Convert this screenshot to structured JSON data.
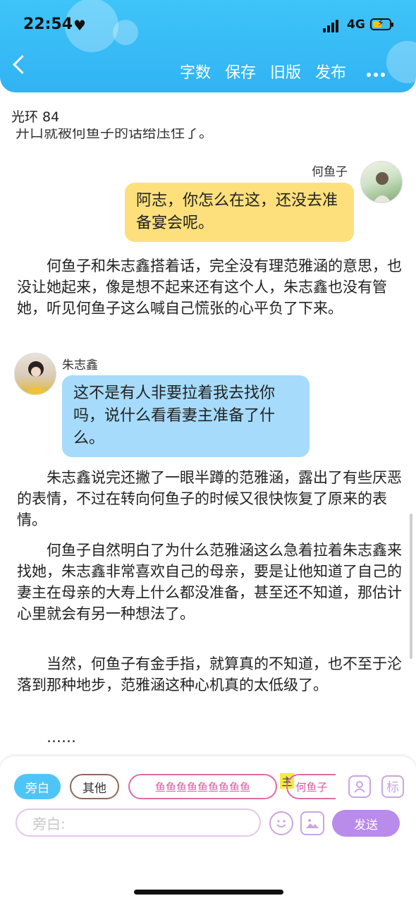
{
  "status_bar": {
    "time": "22:54",
    "network": "4G"
  },
  "nav": {
    "word_count": "字数",
    "save": "保存",
    "old_version": "旧版",
    "publish": "发布"
  },
  "document": {
    "title": "光环 84",
    "cut_off_line": "开口就被何鱼子的话给压住了。"
  },
  "messages": [
    {
      "speaker": "何鱼子",
      "text": "阿志，你怎么在这，还没去准备宴会呢。",
      "side": "right",
      "color": "#fde07c"
    },
    {
      "speaker": "朱志鑫",
      "text": "这不是有人非要拉着我去找你吗，说什么看看妻主准备了什么。",
      "side": "left",
      "color": "#a6dbfb"
    }
  ],
  "paragraphs": [
    "何鱼子和朱志鑫搭着话，完全没有理范雅涵的意思，也没让她起来，像是想不起来还有这个人，朱志鑫也没有管她，听见何鱼子这么喊自己慌张的心平负了下来。",
    "朱志鑫说完还撇了一眼半蹲的范雅涵，露出了有些厌恶的表情，不过在转向何鱼子的时候又很快恢复了原来的表情。",
    "何鱼子自然明白了为什么范雅涵这么急着拉着朱志鑫来找她，朱志鑫非常喜欢自己的母亲，要是让他知道了自己的妻主在母亲的大寿上什么都没准备，甚至还不知道，那估计心里就会有另一种想法了。",
    "当然，何鱼子有金手指，就算真的不知道，也不至于沦落到那种地步，范雅涵这种心机真的太低级了。",
    "……"
  ],
  "toolbar": {
    "narration_chip": "旁白",
    "other_chip": "其他",
    "role_chip_long": "鱼鱼鱼鱼鱼鱼鱼鱼鱼",
    "main_tag": "主",
    "role_chip_main": "何鱼子",
    "tag_icon_label": "标",
    "input_placeholder": "旁白:",
    "send_label": "发送"
  },
  "colors": {
    "header": "#31b3f3",
    "accent_purple": "#b98bea",
    "narration_chip": "#4fc4f7"
  }
}
